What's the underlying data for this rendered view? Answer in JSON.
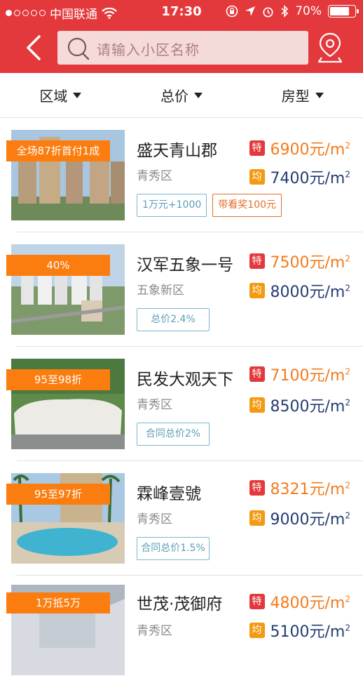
{
  "status": {
    "carrier": "中国联通",
    "time": "17:30",
    "battery": "70%",
    "signal_bars_filled": 1
  },
  "nav": {
    "search_placeholder": "请输入小区名称"
  },
  "filters": [
    {
      "label": "区域"
    },
    {
      "label": "总价"
    },
    {
      "label": "房型"
    }
  ],
  "listings": [
    {
      "name": "盛天青山郡",
      "district": "青秀区",
      "promo": "全场87折首付1成",
      "special_price": "6900元/m",
      "avg_price": "7400元/m",
      "tags": [
        {
          "text": "1万元+1000",
          "style": "blue"
        },
        {
          "text": "带看奖100元",
          "style": "orange"
        }
      ]
    },
    {
      "name": "汉军五象一号",
      "district": "五象新区",
      "promo": "40%",
      "special_price": "7500元/m",
      "avg_price": "8000元/m",
      "tags": [
        {
          "text": "总价2.4%",
          "style": "blue"
        }
      ]
    },
    {
      "name": "民发大观天下",
      "district": "青秀区",
      "promo": "95至98折",
      "special_price": "7100元/m",
      "avg_price": "8500元/m",
      "tags": [
        {
          "text": "合同总价2%",
          "style": "blue"
        }
      ]
    },
    {
      "name": "霖峰壹號",
      "district": "青秀区",
      "promo": "95至97折",
      "special_price": "8321元/m",
      "avg_price": "9000元/m",
      "tags": [
        {
          "text": "合同总价1.5%",
          "style": "blue"
        }
      ]
    },
    {
      "name": "世茂·茂御府",
      "district": "青秀区",
      "promo": "1万抵5万",
      "special_price": "4800元/m",
      "avg_price": "5100元/m",
      "tags": []
    }
  ],
  "badges": {
    "special": "特",
    "average": "均",
    "area_unit": "2"
  },
  "colors": {
    "brand_red": "#e4393c",
    "promo_orange": "#fb7d10",
    "special_price": "#f57a1a",
    "avg_price": "#253b73"
  }
}
